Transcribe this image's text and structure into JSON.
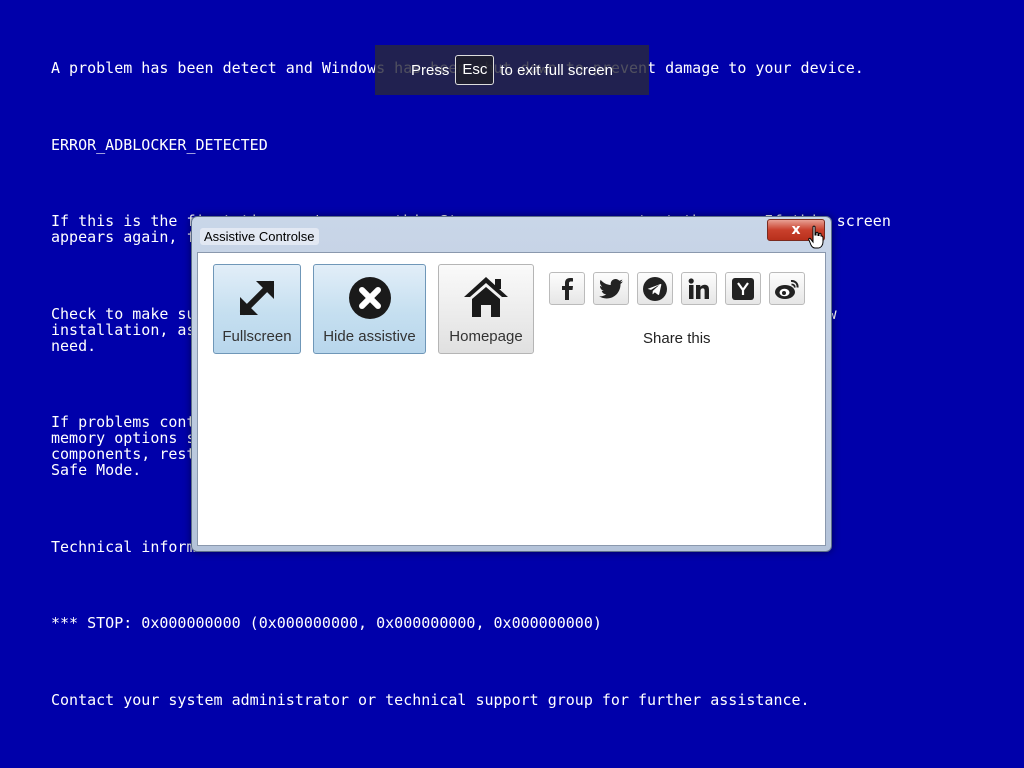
{
  "bsod": {
    "line1": "A problem has been detect and Windows has been shut down to prevent damage to your device.",
    "error_code": "ERROR_ADBLOCKER_DETECTED",
    "para1_line1": "If this is the first time you've seen this Stop error screen, restart the app. If this screen",
    "para1_line2": "appears again, follow these steps:",
    "para2_line1": "Check to make sure any new hardware or software is properly installed. If this is a new",
    "para2_line2": "installation, ask your hardware or software manufacturer for any updates you might",
    "para2_line3": "need.",
    "para3_line1": "If problems continue, disable or remove any newly installed hardware. Disable BIOS",
    "para3_line2": "memory options such as caching or shadowing. If you need to remove or disable",
    "para3_line3": "components, restart your computer, press F8 to select Advanced and then select",
    "para3_line4": "Safe Mode.",
    "tech_info": "Technical information:",
    "stop_code": "*** STOP: 0x000000000 (0x000000000, 0x000000000, 0x000000000)",
    "contact": "Contact your system administrator or technical support group for further assistance."
  },
  "fullscreen_toast": {
    "press": "Press",
    "key": "Esc",
    "suffix": "to exit full screen"
  },
  "assist": {
    "title": "Assistive Controlse",
    "close_label": "x",
    "buttons": [
      {
        "label": "Fullscreen",
        "icon": "fullscreen-icon"
      },
      {
        "label": "Hide assistive",
        "icon": "close-circle-icon"
      },
      {
        "label": "Homepage",
        "icon": "home-icon"
      }
    ],
    "share": {
      "label": "Share this",
      "icons": [
        "facebook-icon",
        "twitter-icon",
        "telegram-icon",
        "linkedin-icon",
        "ycombinator-icon",
        "weibo-icon"
      ]
    }
  },
  "colors": {
    "bsod_background": "#0000aa",
    "text": "#ffffff"
  }
}
